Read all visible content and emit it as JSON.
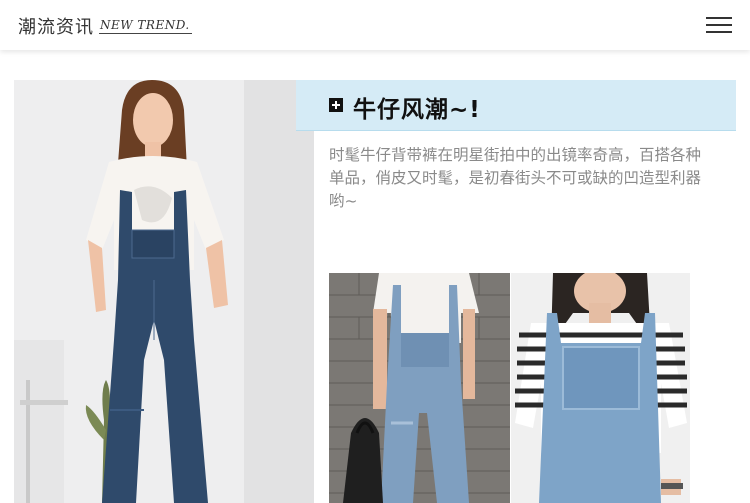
{
  "header": {
    "brand_cn": "潮流资讯",
    "brand_en": "NEW TREND."
  },
  "article": {
    "title": "牛仔风潮~!",
    "description": "时髦牛仔背带裤在明星街拍中的出镜率奇高，百搭各种单品，俏皮又时髦，是初春街头不可或缺的凹造型利器哟~"
  },
  "colors": {
    "title_bar": "#d5ebf6",
    "denim": "#2f4a6b",
    "text_gray": "#8a8a8a"
  },
  "icons": [
    "menu-icon",
    "plus-square-icon"
  ]
}
